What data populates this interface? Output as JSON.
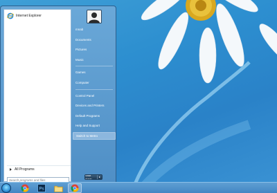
{
  "start_menu": {
    "pinned": [
      {
        "label": "Internet Explorer",
        "icon": "ie-icon"
      }
    ],
    "all_programs_label": "All Programs",
    "search_placeholder": "Search programs and files",
    "right_items": [
      {
        "label": "mnab",
        "highlighted": false
      },
      {
        "label": "Documents",
        "highlighted": false
      },
      {
        "label": "Pictures",
        "highlighted": false
      },
      {
        "label": "Music",
        "highlighted": false
      },
      {
        "label": "Games",
        "highlighted": false
      },
      {
        "label": "Computer",
        "highlighted": false
      },
      {
        "label": "Control Panel",
        "highlighted": false
      },
      {
        "label": "Devices and Printers",
        "highlighted": false
      },
      {
        "label": "Default Programs",
        "highlighted": false
      },
      {
        "label": "Help and Support",
        "highlighted": false
      },
      {
        "label": "Switch to Metro",
        "highlighted": true
      }
    ],
    "shutdown_label": "Shut down"
  },
  "taskbar": {
    "items": [
      {
        "name": "start-orb",
        "icon": "windows-orb-icon"
      },
      {
        "name": "chrome",
        "icon": "chrome-icon",
        "active": false
      },
      {
        "name": "photoshop",
        "icon": "photoshop-icon",
        "label": "Ps",
        "active": false
      },
      {
        "name": "explorer",
        "icon": "folder-icon",
        "active": false
      },
      {
        "name": "chrome-2",
        "icon": "chrome-icon",
        "active": true
      }
    ]
  },
  "colors": {
    "menu_blue": "#4f8fc6",
    "taskbar_blue": "#4386c3",
    "highlight": "#8cb7de",
    "wallpaper": "#2d8fd0"
  }
}
